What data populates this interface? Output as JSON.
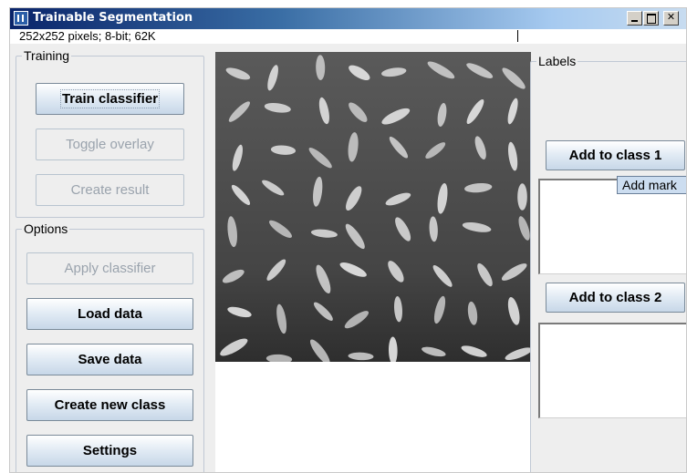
{
  "window": {
    "title": "Trainable Segmentation"
  },
  "info": {
    "image_info": "252x252 pixels; 8-bit; 62K"
  },
  "training": {
    "group_label": "Training",
    "train_classifier": "Train classifier",
    "toggle_overlay": "Toggle overlay",
    "create_result": "Create result"
  },
  "options": {
    "group_label": "Options",
    "apply_classifier": "Apply classifier",
    "load_data": "Load data",
    "save_data": "Save data",
    "create_new_class": "Create new class",
    "settings": "Settings"
  },
  "labels": {
    "group_label": "Labels",
    "add_class_1": "Add to class 1",
    "add_class_2": "Add to class 2",
    "tooltip": "Add mark"
  },
  "colors": {
    "titlebar_dark": "#0a246a",
    "button_border": "#7a8a99",
    "disabled_text": "#9aa3ad",
    "tooltip_bg": "#ccddf0"
  }
}
